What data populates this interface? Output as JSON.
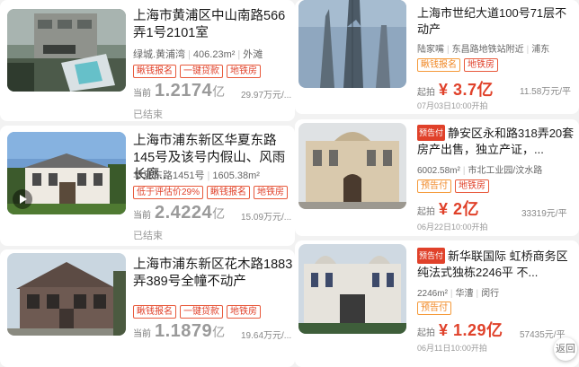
{
  "left": [
    {
      "title": "上海市黄浦区中山南路566弄1号2101室",
      "meta": [
        "绿城.黄浦湾",
        "406.23m²",
        "外滩"
      ],
      "tags": [
        "瞅钱报名",
        "一键贷款",
        "地铁房"
      ],
      "price_label": "当前",
      "price": "1.2174",
      "price_unit": "亿",
      "unit_price": "29.97万元/...",
      "status": "已结束"
    },
    {
      "title": "上海市浦东新区华夏东路145号及该号内假山、风雨长廊...",
      "meta": [
        "华夏东路1451号",
        "1605.38m²"
      ],
      "tags": [
        "低于评估价29%",
        "瞅钱报名",
        "地铁房"
      ],
      "price_label": "当前",
      "price": "2.4224",
      "price_unit": "亿",
      "unit_price": "15.09万元/...",
      "status": "已结束"
    },
    {
      "title": "上海市浦东新区花木路1883弄389号全幢不动产",
      "meta": [],
      "tags": [
        "瞅钱报名",
        "一键贷款",
        "地铁房"
      ],
      "price_label": "当前",
      "price": "1.1879",
      "price_unit": "亿",
      "unit_price": "19.64万元/..."
    }
  ],
  "right": [
    {
      "title": "上海市世纪大道100号71层不动产",
      "meta": [
        "陆家嘴",
        "东昌路地铁站附近",
        "浦东"
      ],
      "tags": [
        "瞅钱报名",
        "地铁房"
      ],
      "price_label": "起拍",
      "price": "¥ 3.7亿",
      "unit_price": "11.58万元/平",
      "date": "07月03日10:00开拍"
    },
    {
      "pre_badge": "预告付",
      "title": "静安区永和路318弄20套房产出售，独立产证，...",
      "meta": [
        "6002.58m²",
        "市北工业园/汶水路"
      ],
      "tags": [
        "预告付",
        "地铁房"
      ],
      "price_label": "起拍",
      "price": "¥ 2亿",
      "unit_price": "33319元/平",
      "date": "06月22日10:00开拍"
    },
    {
      "pre_badge": "预告付",
      "title": "新华联国际 虹桥商务区 纯法式独栋2246平 不...",
      "meta": [
        "2246m²",
        "华漕",
        "闵行"
      ],
      "tags": [
        "预告付"
      ],
      "price_label": "起拍",
      "price": "¥ 1.29亿",
      "unit_price": "57435元/平",
      "date": "06月11日10:00开拍"
    }
  ],
  "fab_label": "返回"
}
